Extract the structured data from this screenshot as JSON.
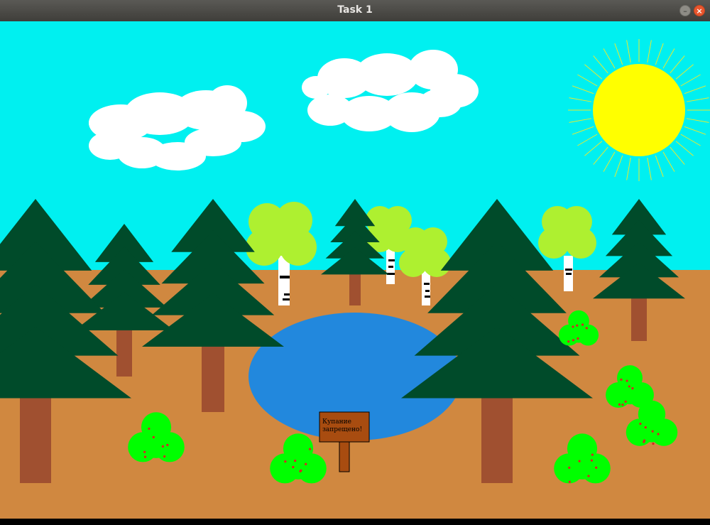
{
  "window": {
    "title": "Task 1",
    "minimize_glyph": "–",
    "close_glyph": "×"
  },
  "scene": {
    "sign": {
      "line1": "Купание",
      "line2": "запрещено!"
    }
  },
  "colors": {
    "sky": "#00f0f0",
    "ground": "#d08840",
    "sun": "#ffff00",
    "lake": "#2288dd",
    "spruce": "#004b2a",
    "trunk": "#a05030",
    "birch_crown": "#aef030",
    "bush": "#00ff00",
    "berry": "#dd2222",
    "sign_board": "#a84c10"
  }
}
